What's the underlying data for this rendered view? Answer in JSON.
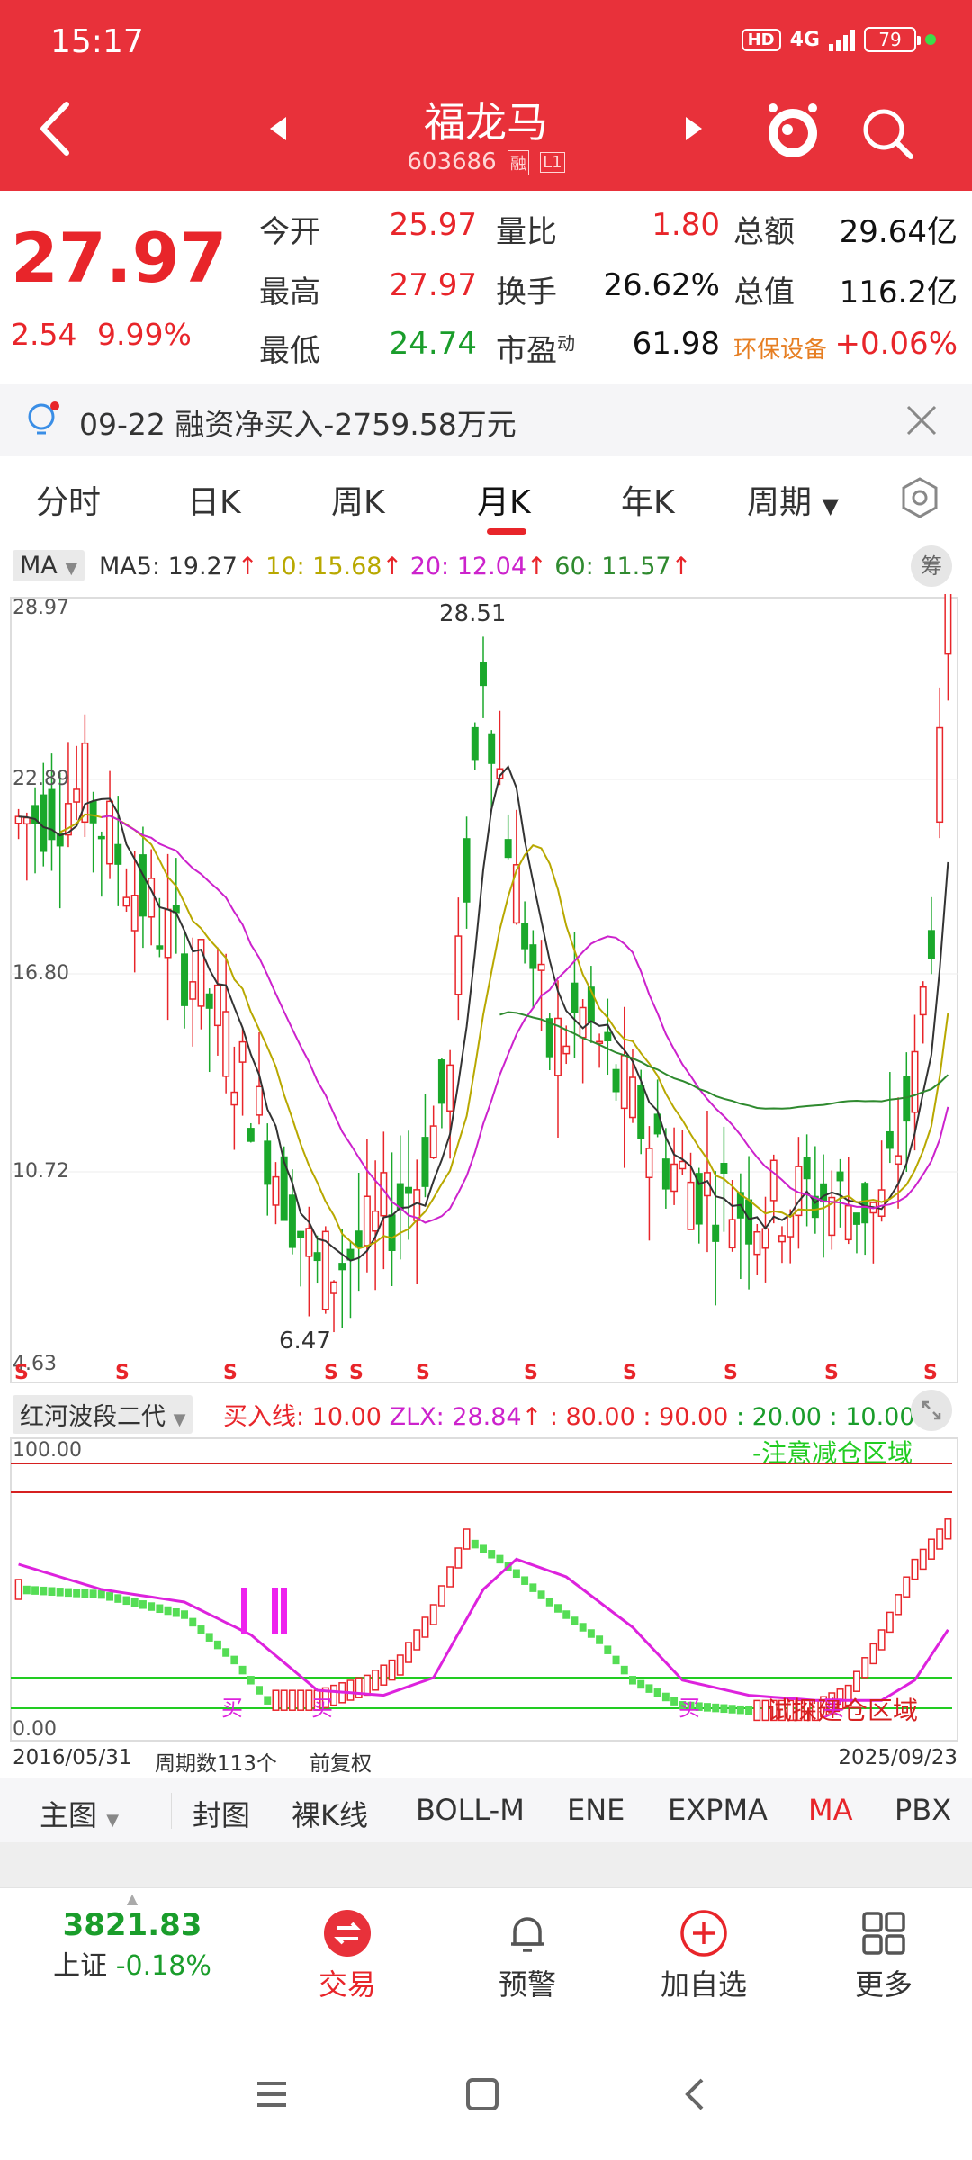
{
  "status_bar": {
    "time": "15:17",
    "hd": "HD",
    "network": "4G",
    "battery": "79"
  },
  "header": {
    "name": "福龙马",
    "code": "603686",
    "tag1": "融",
    "tag2": "L1"
  },
  "quote": {
    "price": "27.97",
    "change": "2.54",
    "change_pct": "9.99%",
    "rows": [
      {
        "l1": "今开",
        "v1": "25.97",
        "l2": "量比",
        "v2": "1.80",
        "l3": "总额",
        "v3": "29.64亿"
      },
      {
        "l1": "最高",
        "v1": "27.97",
        "l2": "换手",
        "v2": "26.62%",
        "l3": "总值",
        "v3": "116.2亿"
      },
      {
        "l1": "最低",
        "v1": "24.74",
        "l2": "市盈",
        "v2": "61.98",
        "l3": "环保设备",
        "v3": "+0.06%"
      }
    ],
    "pe_sup": "动"
  },
  "notice": {
    "text": "09-22 融资净买入-2759.58万元"
  },
  "tabs": [
    "分时",
    "日K",
    "周K",
    "月K",
    "年K",
    "周期"
  ],
  "ma_bar": {
    "select": "MA",
    "ma5": "MA5: 19.27",
    "ma10": "10: 15.68",
    "ma20": "20: 12.04",
    "ma60": "60: 11.57",
    "chip": "筹",
    "colors": {
      "ma5": "#333333",
      "ma10": "#b8a800",
      "ma20": "#cc22cc",
      "ma60": "#2f8a2f"
    }
  },
  "main_chart": {
    "y_top": "28.97",
    "y_mid1": "22.89",
    "y_mid2": "16.80",
    "y_mid3": "10.72",
    "y_bottom": "4.63",
    "high_label": "28.51",
    "low_label": "6.47",
    "s_marker": "S"
  },
  "indicator_bar": {
    "select": "红河波段二代",
    "buy_line": "买入线: 10.00",
    "zlx": "ZLX: 28.84",
    "v80": ": 80.00",
    "v90": ": 90.00",
    "v20": ": 20.00",
    "v10": ": 10.00"
  },
  "indicator_chart": {
    "y_top": "100.00",
    "y_bottom": "0.00",
    "reduce_zone": "-注意减仓区域",
    "build_zone": "试探建仓区域",
    "buy_marker": "买"
  },
  "date_row": {
    "start": "2016/05/31",
    "periods": "周期数113个",
    "adjust": "前复权",
    "end": "2025/09/23"
  },
  "indicator_tabs": [
    "主图",
    "封图",
    "裸K线",
    "BOLL-M",
    "ENE",
    "EXPMA",
    "MA",
    "PBX"
  ],
  "bottom_nav": {
    "index_value": "3821.83",
    "index_name": "上证",
    "index_change": "-0.18%",
    "trade": "交易",
    "alert": "预警",
    "add": "加自选",
    "more": "更多"
  }
}
